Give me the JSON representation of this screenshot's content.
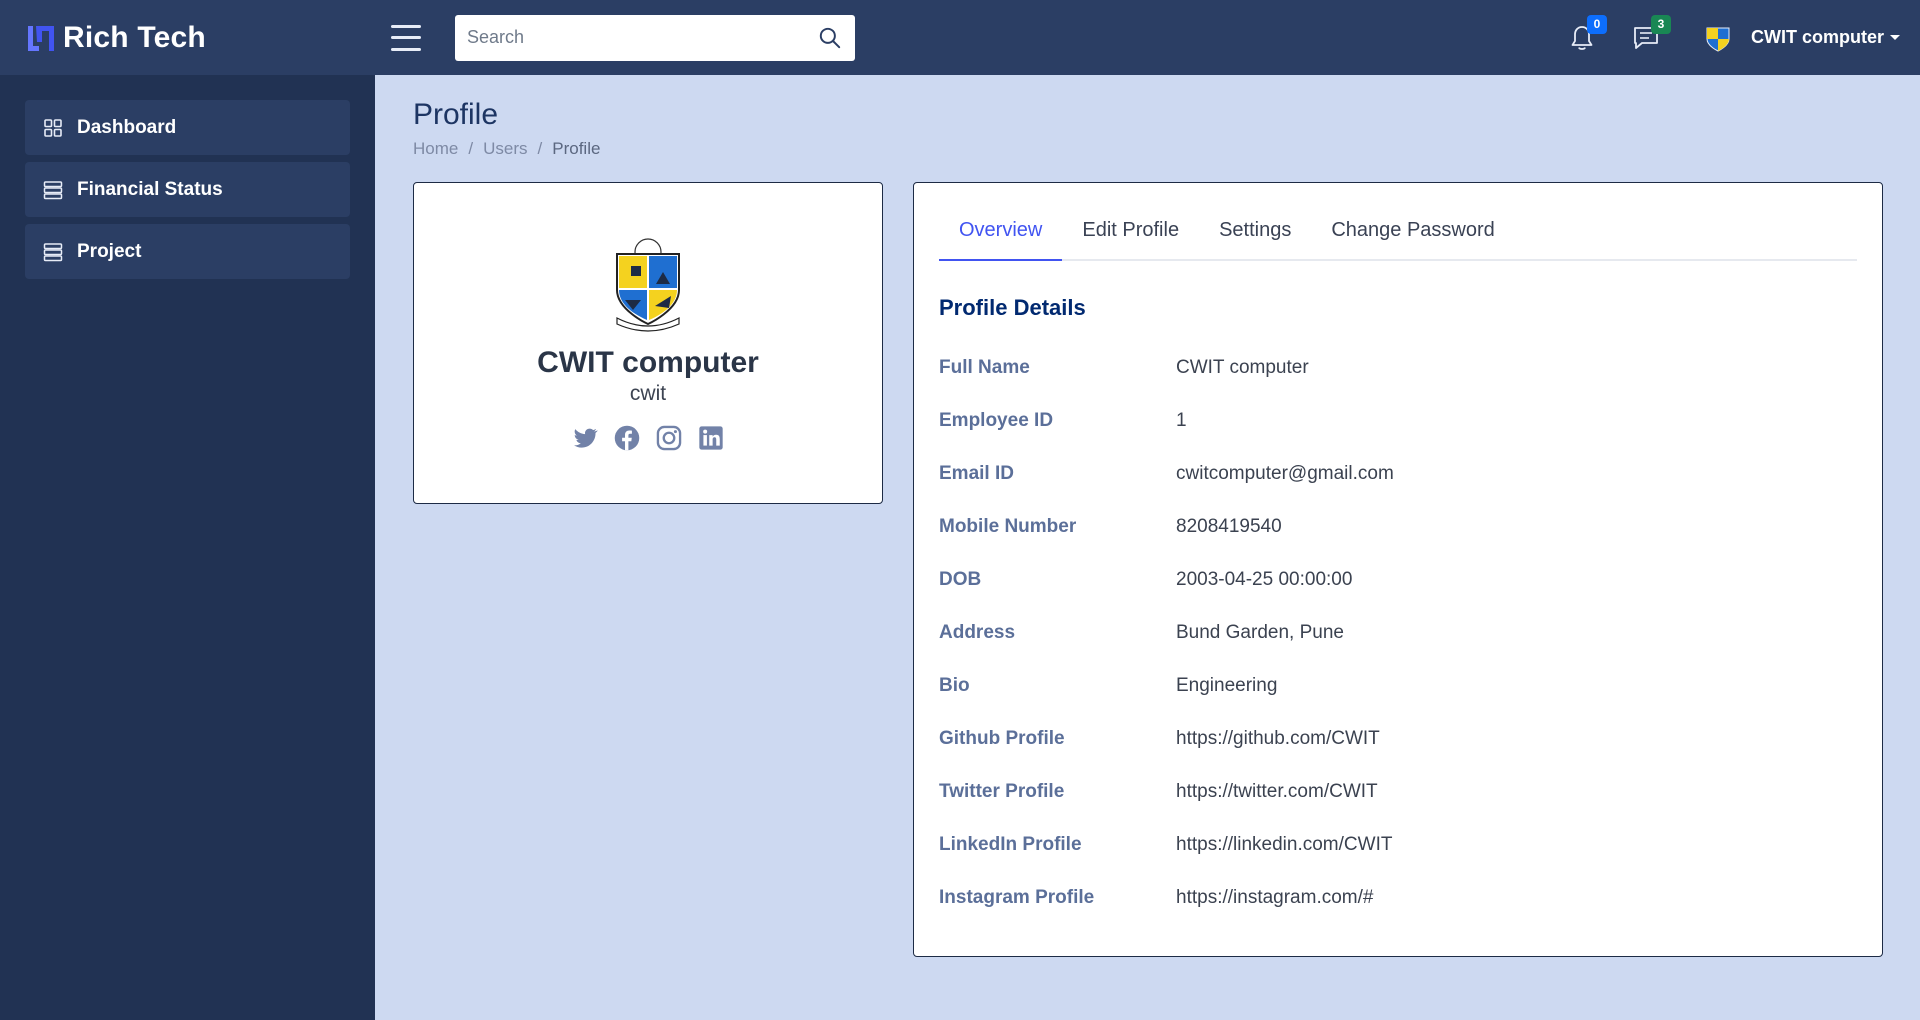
{
  "brand": {
    "name": "Rich Tech"
  },
  "header": {
    "search_placeholder": "Search",
    "notifications_count": "0",
    "messages_count": "3",
    "user_name": "CWIT computer"
  },
  "sidebar": {
    "items": [
      {
        "label": "Dashboard",
        "icon": "grid-icon"
      },
      {
        "label": "Financial Status",
        "icon": "server-icon"
      },
      {
        "label": "Project",
        "icon": "server-icon"
      }
    ]
  },
  "page": {
    "title": "Profile",
    "breadcrumb": [
      "Home",
      "Users",
      "Profile"
    ]
  },
  "profile_card": {
    "name": "CWIT computer",
    "username": "cwit",
    "socials": [
      "twitter-icon",
      "facebook-icon",
      "instagram-icon",
      "linkedin-icon"
    ]
  },
  "tabs": [
    "Overview",
    "Edit Profile",
    "Settings",
    "Change Password"
  ],
  "details": {
    "title": "Profile Details",
    "rows": [
      {
        "label": "Full Name",
        "value": "CWIT computer"
      },
      {
        "label": "Employee ID",
        "value": "1"
      },
      {
        "label": "Email ID",
        "value": "cwitcomputer@gmail.com"
      },
      {
        "label": "Mobile Number",
        "value": "8208419540"
      },
      {
        "label": "DOB",
        "value": "2003-04-25 00:00:00"
      },
      {
        "label": "Address",
        "value": "Bund Garden, Pune"
      },
      {
        "label": "Bio",
        "value": "Engineering"
      },
      {
        "label": "Github Profile",
        "value": "https://github.com/CWIT"
      },
      {
        "label": "Twitter Profile",
        "value": "https://twitter.com/CWIT"
      },
      {
        "label": "LinkedIn Profile",
        "value": "https://linkedin.com/CWIT"
      },
      {
        "label": "Instagram Profile",
        "value": "https://instagram.com/#"
      }
    ]
  },
  "colors": {
    "header_bg": "#2b3e64",
    "sidebar_bg": "#213253",
    "page_bg": "#cdd9f1",
    "accent": "#4154f1"
  }
}
